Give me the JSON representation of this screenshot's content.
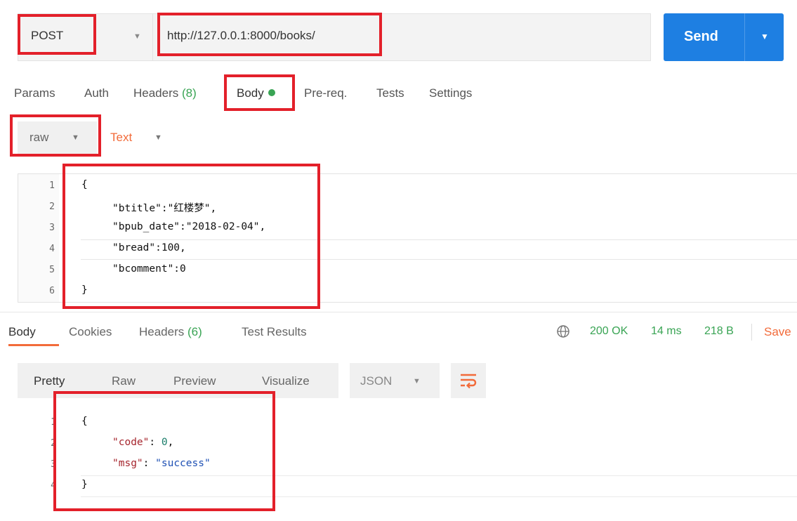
{
  "request": {
    "method": "POST",
    "url": "http://127.0.0.1:8000/books/",
    "send_label": "Send"
  },
  "request_tabs": [
    {
      "label": "Params"
    },
    {
      "label": "Auth"
    },
    {
      "label": "Headers",
      "count": "(8)"
    },
    {
      "label": "Body"
    },
    {
      "label": "Pre-req."
    },
    {
      "label": "Tests"
    },
    {
      "label": "Settings"
    }
  ],
  "body_options": {
    "mode": "raw",
    "format": "Text"
  },
  "request_body": {
    "line_numbers": [
      "1",
      "2",
      "3",
      "4",
      "5",
      "6"
    ],
    "lines": [
      "{",
      "\"btitle\":\"红楼梦\",",
      "\"bpub_date\":\"2018-02-04\",",
      "\"bread\":100,",
      "\"bcomment\":0",
      "}"
    ]
  },
  "response_tabs": [
    {
      "label": "Body"
    },
    {
      "label": "Cookies"
    },
    {
      "label": "Headers",
      "count": "(6)"
    },
    {
      "label": "Test Results"
    }
  ],
  "response_status": {
    "status": "200 OK",
    "time": "14 ms",
    "size": "218 B",
    "save_label": "Save"
  },
  "response_view": {
    "modes": [
      "Pretty",
      "Raw",
      "Preview",
      "Visualize"
    ],
    "format": "JSON"
  },
  "response_body": {
    "line_numbers": [
      "1",
      "2",
      "3",
      "4"
    ],
    "code_key": "\"code\"",
    "code_value": "0",
    "msg_key": "\"msg\"",
    "msg_value": "\"success\""
  },
  "colors": {
    "accent": "#f26b3a",
    "send": "#1e7fe2",
    "success": "#39a454",
    "annotation": "#e3202a"
  }
}
